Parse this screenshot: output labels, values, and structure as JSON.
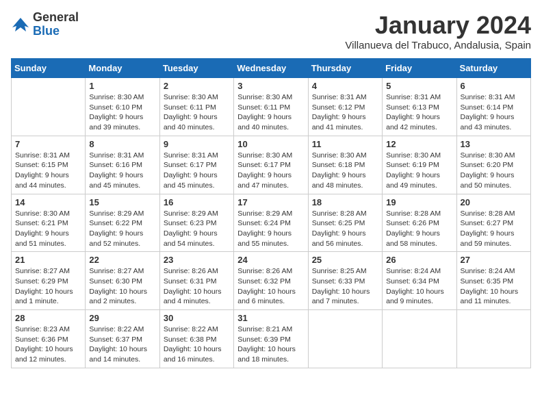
{
  "header": {
    "logo_general": "General",
    "logo_blue": "Blue",
    "month_title": "January 2024",
    "location": "Villanueva del Trabuco, Andalusia, Spain"
  },
  "days_of_week": [
    "Sunday",
    "Monday",
    "Tuesday",
    "Wednesday",
    "Thursday",
    "Friday",
    "Saturday"
  ],
  "weeks": [
    [
      {
        "day": "",
        "info": ""
      },
      {
        "day": "1",
        "info": "Sunrise: 8:30 AM\nSunset: 6:10 PM\nDaylight: 9 hours\nand 39 minutes."
      },
      {
        "day": "2",
        "info": "Sunrise: 8:30 AM\nSunset: 6:11 PM\nDaylight: 9 hours\nand 40 minutes."
      },
      {
        "day": "3",
        "info": "Sunrise: 8:30 AM\nSunset: 6:11 PM\nDaylight: 9 hours\nand 40 minutes."
      },
      {
        "day": "4",
        "info": "Sunrise: 8:31 AM\nSunset: 6:12 PM\nDaylight: 9 hours\nand 41 minutes."
      },
      {
        "day": "5",
        "info": "Sunrise: 8:31 AM\nSunset: 6:13 PM\nDaylight: 9 hours\nand 42 minutes."
      },
      {
        "day": "6",
        "info": "Sunrise: 8:31 AM\nSunset: 6:14 PM\nDaylight: 9 hours\nand 43 minutes."
      }
    ],
    [
      {
        "day": "7",
        "info": "Sunrise: 8:31 AM\nSunset: 6:15 PM\nDaylight: 9 hours\nand 44 minutes."
      },
      {
        "day": "8",
        "info": "Sunrise: 8:31 AM\nSunset: 6:16 PM\nDaylight: 9 hours\nand 45 minutes."
      },
      {
        "day": "9",
        "info": "Sunrise: 8:31 AM\nSunset: 6:17 PM\nDaylight: 9 hours\nand 45 minutes."
      },
      {
        "day": "10",
        "info": "Sunrise: 8:30 AM\nSunset: 6:17 PM\nDaylight: 9 hours\nand 47 minutes."
      },
      {
        "day": "11",
        "info": "Sunrise: 8:30 AM\nSunset: 6:18 PM\nDaylight: 9 hours\nand 48 minutes."
      },
      {
        "day": "12",
        "info": "Sunrise: 8:30 AM\nSunset: 6:19 PM\nDaylight: 9 hours\nand 49 minutes."
      },
      {
        "day": "13",
        "info": "Sunrise: 8:30 AM\nSunset: 6:20 PM\nDaylight: 9 hours\nand 50 minutes."
      }
    ],
    [
      {
        "day": "14",
        "info": "Sunrise: 8:30 AM\nSunset: 6:21 PM\nDaylight: 9 hours\nand 51 minutes."
      },
      {
        "day": "15",
        "info": "Sunrise: 8:29 AM\nSunset: 6:22 PM\nDaylight: 9 hours\nand 52 minutes."
      },
      {
        "day": "16",
        "info": "Sunrise: 8:29 AM\nSunset: 6:23 PM\nDaylight: 9 hours\nand 54 minutes."
      },
      {
        "day": "17",
        "info": "Sunrise: 8:29 AM\nSunset: 6:24 PM\nDaylight: 9 hours\nand 55 minutes."
      },
      {
        "day": "18",
        "info": "Sunrise: 8:28 AM\nSunset: 6:25 PM\nDaylight: 9 hours\nand 56 minutes."
      },
      {
        "day": "19",
        "info": "Sunrise: 8:28 AM\nSunset: 6:26 PM\nDaylight: 9 hours\nand 58 minutes."
      },
      {
        "day": "20",
        "info": "Sunrise: 8:28 AM\nSunset: 6:27 PM\nDaylight: 9 hours\nand 59 minutes."
      }
    ],
    [
      {
        "day": "21",
        "info": "Sunrise: 8:27 AM\nSunset: 6:29 PM\nDaylight: 10 hours\nand 1 minute."
      },
      {
        "day": "22",
        "info": "Sunrise: 8:27 AM\nSunset: 6:30 PM\nDaylight: 10 hours\nand 2 minutes."
      },
      {
        "day": "23",
        "info": "Sunrise: 8:26 AM\nSunset: 6:31 PM\nDaylight: 10 hours\nand 4 minutes."
      },
      {
        "day": "24",
        "info": "Sunrise: 8:26 AM\nSunset: 6:32 PM\nDaylight: 10 hours\nand 6 minutes."
      },
      {
        "day": "25",
        "info": "Sunrise: 8:25 AM\nSunset: 6:33 PM\nDaylight: 10 hours\nand 7 minutes."
      },
      {
        "day": "26",
        "info": "Sunrise: 8:24 AM\nSunset: 6:34 PM\nDaylight: 10 hours\nand 9 minutes."
      },
      {
        "day": "27",
        "info": "Sunrise: 8:24 AM\nSunset: 6:35 PM\nDaylight: 10 hours\nand 11 minutes."
      }
    ],
    [
      {
        "day": "28",
        "info": "Sunrise: 8:23 AM\nSunset: 6:36 PM\nDaylight: 10 hours\nand 12 minutes."
      },
      {
        "day": "29",
        "info": "Sunrise: 8:22 AM\nSunset: 6:37 PM\nDaylight: 10 hours\nand 14 minutes."
      },
      {
        "day": "30",
        "info": "Sunrise: 8:22 AM\nSunset: 6:38 PM\nDaylight: 10 hours\nand 16 minutes."
      },
      {
        "day": "31",
        "info": "Sunrise: 8:21 AM\nSunset: 6:39 PM\nDaylight: 10 hours\nand 18 minutes."
      },
      {
        "day": "",
        "info": ""
      },
      {
        "day": "",
        "info": ""
      },
      {
        "day": "",
        "info": ""
      }
    ]
  ]
}
